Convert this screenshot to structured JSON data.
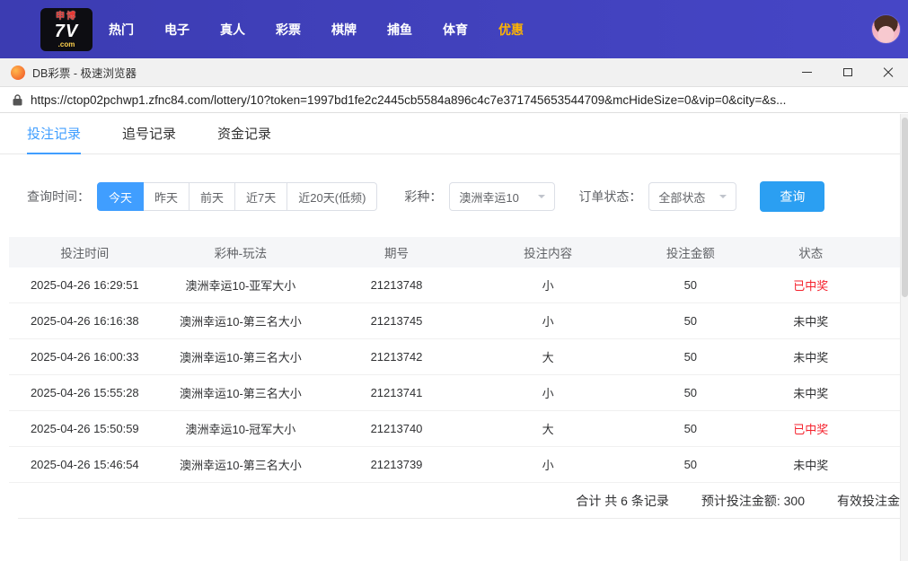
{
  "site_header": {
    "logo": {
      "top": "申博",
      "main": "7V",
      "bottom": ".com"
    },
    "nav_items": [
      {
        "label": "热门"
      },
      {
        "label": "电子"
      },
      {
        "label": "真人"
      },
      {
        "label": "彩票"
      },
      {
        "label": "棋牌"
      },
      {
        "label": "捕鱼"
      },
      {
        "label": "体育"
      },
      {
        "label": "优惠"
      }
    ]
  },
  "browser": {
    "window_title": "DB彩票 - 极速浏览器",
    "url": "https://ctop02pchwp1.zfnc84.com/lottery/10?token=1997bd1fe2c2445cb5584a896c4c7e371745653544709&mcHideSize=0&vip=0&city=&s..."
  },
  "page": {
    "tabs": [
      {
        "label": "投注记录",
        "active": true
      },
      {
        "label": "追号记录",
        "active": false
      },
      {
        "label": "资金记录",
        "active": false
      }
    ],
    "filters": {
      "time_label": "查询时间：",
      "time_options": [
        {
          "label": "今天",
          "active": true
        },
        {
          "label": "昨天",
          "active": false
        },
        {
          "label": "前天",
          "active": false
        },
        {
          "label": "近7天",
          "active": false
        },
        {
          "label": "近20天(低频)",
          "active": false
        }
      ],
      "lottery_label": "彩种：",
      "lottery_selected": "澳洲幸运10",
      "order_status_label": "订单状态：",
      "order_status_selected": "全部状态",
      "query_button": "查询"
    },
    "table": {
      "headers": [
        "投注时间",
        "彩种-玩法",
        "期号",
        "投注内容",
        "投注金额",
        "状态"
      ],
      "rows": [
        {
          "time": "2025-04-26 16:29:51",
          "game": "澳洲幸运10-亚军大小",
          "issue": "21213748",
          "content": "小",
          "amount": "50",
          "status": "已中奖",
          "won": true
        },
        {
          "time": "2025-04-26 16:16:38",
          "game": "澳洲幸运10-第三名大小",
          "issue": "21213745",
          "content": "小",
          "amount": "50",
          "status": "未中奖",
          "won": false
        },
        {
          "time": "2025-04-26 16:00:33",
          "game": "澳洲幸运10-第三名大小",
          "issue": "21213742",
          "content": "大",
          "amount": "50",
          "status": "未中奖",
          "won": false
        },
        {
          "time": "2025-04-26 15:55:28",
          "game": "澳洲幸运10-第三名大小",
          "issue": "21213741",
          "content": "小",
          "amount": "50",
          "status": "未中奖",
          "won": false
        },
        {
          "time": "2025-04-26 15:50:59",
          "game": "澳洲幸运10-冠军大小",
          "issue": "21213740",
          "content": "大",
          "amount": "50",
          "status": "已中奖",
          "won": true
        },
        {
          "time": "2025-04-26 15:46:54",
          "game": "澳洲幸运10-第三名大小",
          "issue": "21213739",
          "content": "小",
          "amount": "50",
          "status": "未中奖",
          "won": false
        }
      ],
      "summary": {
        "total_text": "合计 共 6 条记录",
        "expected_text": "预计投注金额: 300",
        "valid_text": "有效投注金"
      }
    }
  },
  "colors": {
    "accent_blue": "#409eff",
    "won_red": "#f5222d",
    "header_purple": "#4040bc",
    "promo_orange": "#ffb400"
  }
}
